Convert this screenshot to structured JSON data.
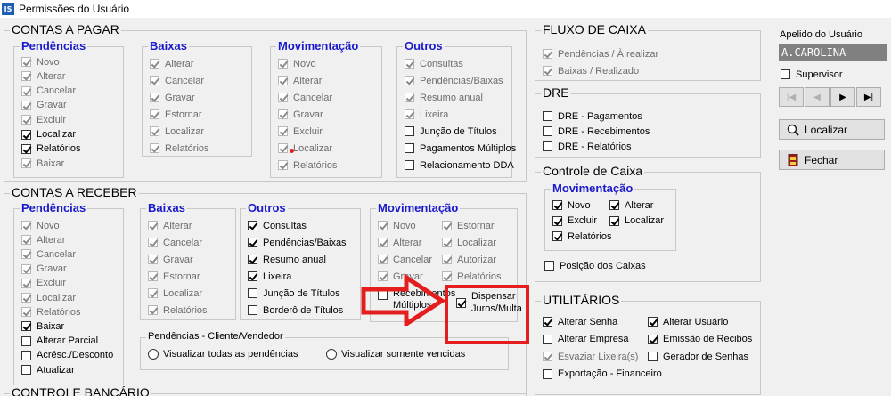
{
  "window": {
    "title": "Permissões do Usuário",
    "icon": "IS"
  },
  "cp": {
    "title": "CONTAS A PAGAR",
    "pendencias": {
      "title": "Pendências",
      "items": [
        {
          "label": "Novo",
          "checked": true,
          "disabled": true
        },
        {
          "label": "Alterar",
          "checked": true,
          "disabled": true
        },
        {
          "label": "Cancelar",
          "checked": true,
          "disabled": true
        },
        {
          "label": "Gravar",
          "checked": true,
          "disabled": true
        },
        {
          "label": "Excluir",
          "checked": true,
          "disabled": true
        },
        {
          "label": "Localizar",
          "checked": true,
          "disabled": false
        },
        {
          "label": "Relatórios",
          "checked": true,
          "disabled": false
        },
        {
          "label": "Baixar",
          "checked": true,
          "disabled": true
        }
      ]
    },
    "baixas": {
      "title": "Baixas",
      "items": [
        {
          "label": "Alterar",
          "checked": true,
          "disabled": true
        },
        {
          "label": "Cancelar",
          "checked": true,
          "disabled": true
        },
        {
          "label": "Gravar",
          "checked": true,
          "disabled": true
        },
        {
          "label": "Estornar",
          "checked": true,
          "disabled": true
        },
        {
          "label": "Localizar",
          "checked": true,
          "disabled": true
        },
        {
          "label": "Relatórios",
          "checked": true,
          "disabled": true
        }
      ]
    },
    "movimentacao": {
      "title": "Movimentação",
      "items": [
        {
          "label": "Novo",
          "checked": true,
          "disabled": true
        },
        {
          "label": "Alterar",
          "checked": true,
          "disabled": true
        },
        {
          "label": "Cancelar",
          "checked": true,
          "disabled": true
        },
        {
          "label": "Gravar",
          "checked": true,
          "disabled": true
        },
        {
          "label": "Excluir",
          "checked": true,
          "disabled": true
        },
        {
          "label": "Localizar",
          "checked": true,
          "disabled": true
        },
        {
          "label": "Relatórios",
          "checked": true,
          "disabled": true
        }
      ]
    },
    "outros": {
      "title": "Outros",
      "items": [
        {
          "label": "Consultas",
          "checked": true,
          "disabled": true
        },
        {
          "label": "Pendências/Baixas",
          "checked": true,
          "disabled": true
        },
        {
          "label": "Resumo anual",
          "checked": true,
          "disabled": true
        },
        {
          "label": "Lixeira",
          "checked": true,
          "disabled": true
        },
        {
          "label": "Junção de Títulos",
          "checked": false,
          "disabled": false
        },
        {
          "label": "Pagamentos Múltiplos",
          "checked": false,
          "disabled": false
        },
        {
          "label": "Relacionamento DDA",
          "checked": false,
          "disabled": false
        }
      ]
    }
  },
  "cr": {
    "title": "CONTAS A RECEBER",
    "pendencias": {
      "title": "Pendências",
      "items": [
        {
          "label": "Novo",
          "checked": true,
          "disabled": true
        },
        {
          "label": "Alterar",
          "checked": true,
          "disabled": true
        },
        {
          "label": "Cancelar",
          "checked": true,
          "disabled": true
        },
        {
          "label": "Gravar",
          "checked": true,
          "disabled": true
        },
        {
          "label": "Excluir",
          "checked": true,
          "disabled": true
        },
        {
          "label": "Localizar",
          "checked": true,
          "disabled": true
        },
        {
          "label": "Relatórios",
          "checked": true,
          "disabled": true
        },
        {
          "label": "Baixar",
          "checked": true,
          "disabled": false
        },
        {
          "label": "Alterar Parcial",
          "checked": false,
          "disabled": false
        },
        {
          "label": "Acrésc./Desconto",
          "checked": false,
          "disabled": false
        },
        {
          "label": "Atualizar",
          "checked": false,
          "disabled": false
        }
      ]
    },
    "baixas": {
      "title": "Baixas",
      "items": [
        {
          "label": "Alterar",
          "checked": true,
          "disabled": true
        },
        {
          "label": "Cancelar",
          "checked": true,
          "disabled": true
        },
        {
          "label": "Gravar",
          "checked": true,
          "disabled": true
        },
        {
          "label": "Estornar",
          "checked": true,
          "disabled": true
        },
        {
          "label": "Localizar",
          "checked": true,
          "disabled": true
        },
        {
          "label": "Relatórios",
          "checked": true,
          "disabled": true
        }
      ]
    },
    "outros": {
      "title": "Outros",
      "items": [
        {
          "label": "Consultas",
          "checked": true,
          "disabled": false
        },
        {
          "label": "Pendências/Baixas",
          "checked": true,
          "disabled": false
        },
        {
          "label": "Resumo anual",
          "checked": true,
          "disabled": false
        },
        {
          "label": "Lixeira",
          "checked": true,
          "disabled": false
        },
        {
          "label": "Junção de Títulos",
          "checked": false,
          "disabled": false
        },
        {
          "label": "Borderô de Títulos",
          "checked": false,
          "disabled": false
        }
      ]
    },
    "movimentacao": {
      "title": "Movimentação",
      "left": [
        {
          "label": "Novo",
          "checked": true,
          "disabled": true
        },
        {
          "label": "Alterar",
          "checked": true,
          "disabled": true
        },
        {
          "label": "Cancelar",
          "checked": true,
          "disabled": true
        },
        {
          "label": "Gravar",
          "checked": true,
          "disabled": true
        }
      ],
      "right": [
        {
          "label": "Estornar",
          "checked": true,
          "disabled": true
        },
        {
          "label": "Localizar",
          "checked": true,
          "disabled": true
        },
        {
          "label": "Autorizar",
          "checked": true,
          "disabled": true
        },
        {
          "label": "Relatórios",
          "checked": true,
          "disabled": true
        }
      ],
      "receb_label": "Recebimentos Múltiplos",
      "receb_checked": false,
      "dispensar_label_1": "Dispensar",
      "dispensar_label_2": "Juros/Multa",
      "dispensar_checked": true
    },
    "visualizacao": {
      "title": "Pendências - Cliente/Vendedor",
      "opt1": "Visualizar todas as pendências",
      "opt2": "Visualizar somente vencidas"
    }
  },
  "fluxo": {
    "title": "FLUXO DE CAIXA",
    "items": [
      {
        "label": "Pendências / À realizar",
        "checked": true,
        "disabled": true
      },
      {
        "label": "Baixas / Realizado",
        "checked": true,
        "disabled": true
      }
    ]
  },
  "dre": {
    "title": "DRE",
    "items": [
      {
        "label": "DRE - Pagamentos",
        "checked": false,
        "disabled": false
      },
      {
        "label": "DRE - Recebimentos",
        "checked": false,
        "disabled": false
      },
      {
        "label": "DRE - Relatórios",
        "checked": false,
        "disabled": false
      }
    ]
  },
  "cc": {
    "title": "Controle de Caixa",
    "mov_title": "Movimentação",
    "mov_left": [
      {
        "label": "Novo",
        "checked": true,
        "disabled": false
      },
      {
        "label": "Excluir",
        "checked": true,
        "disabled": false
      },
      {
        "label": "Relatórios",
        "checked": true,
        "disabled": false
      }
    ],
    "mov_right": [
      {
        "label": "Alterar",
        "checked": true,
        "disabled": false
      },
      {
        "label": "Localizar",
        "checked": true,
        "disabled": false
      }
    ],
    "posicao": {
      "label": "Posição dos Caixas",
      "checked": false,
      "disabled": false
    }
  },
  "util": {
    "title": "UTILITÁRIOS",
    "left": [
      {
        "label": "Alterar Senha",
        "checked": true,
        "disabled": false
      },
      {
        "label": "Alterar Empresa",
        "checked": false,
        "disabled": false
      },
      {
        "label": "Esvaziar Lixeira(s)",
        "checked": true,
        "disabled": true
      },
      {
        "label": "Exportação - Financeiro",
        "checked": false,
        "disabled": false
      }
    ],
    "right": [
      {
        "label": "Alterar Usuário",
        "checked": true,
        "disabled": false
      },
      {
        "label": "Emissão de Recibos",
        "checked": true,
        "disabled": false
      },
      {
        "label": "Gerador de Senhas",
        "checked": false,
        "disabled": false
      }
    ]
  },
  "bancario": {
    "title": "CONTROLE BANCÁRIO"
  },
  "side": {
    "apelido_label": "Apelido do Usuário",
    "apelido_value": "A.CAROLINA",
    "supervisor_label": "Supervisor",
    "supervisor_checked": false,
    "nav": [
      "|◀",
      "◀",
      "▶",
      "▶|"
    ],
    "localizar_label": "Localizar",
    "fechar_label": "Fechar"
  },
  "colors": {
    "title_blue": "#1a1acc",
    "highlight_red": "#e41e1e",
    "field_gray": "#808080"
  }
}
